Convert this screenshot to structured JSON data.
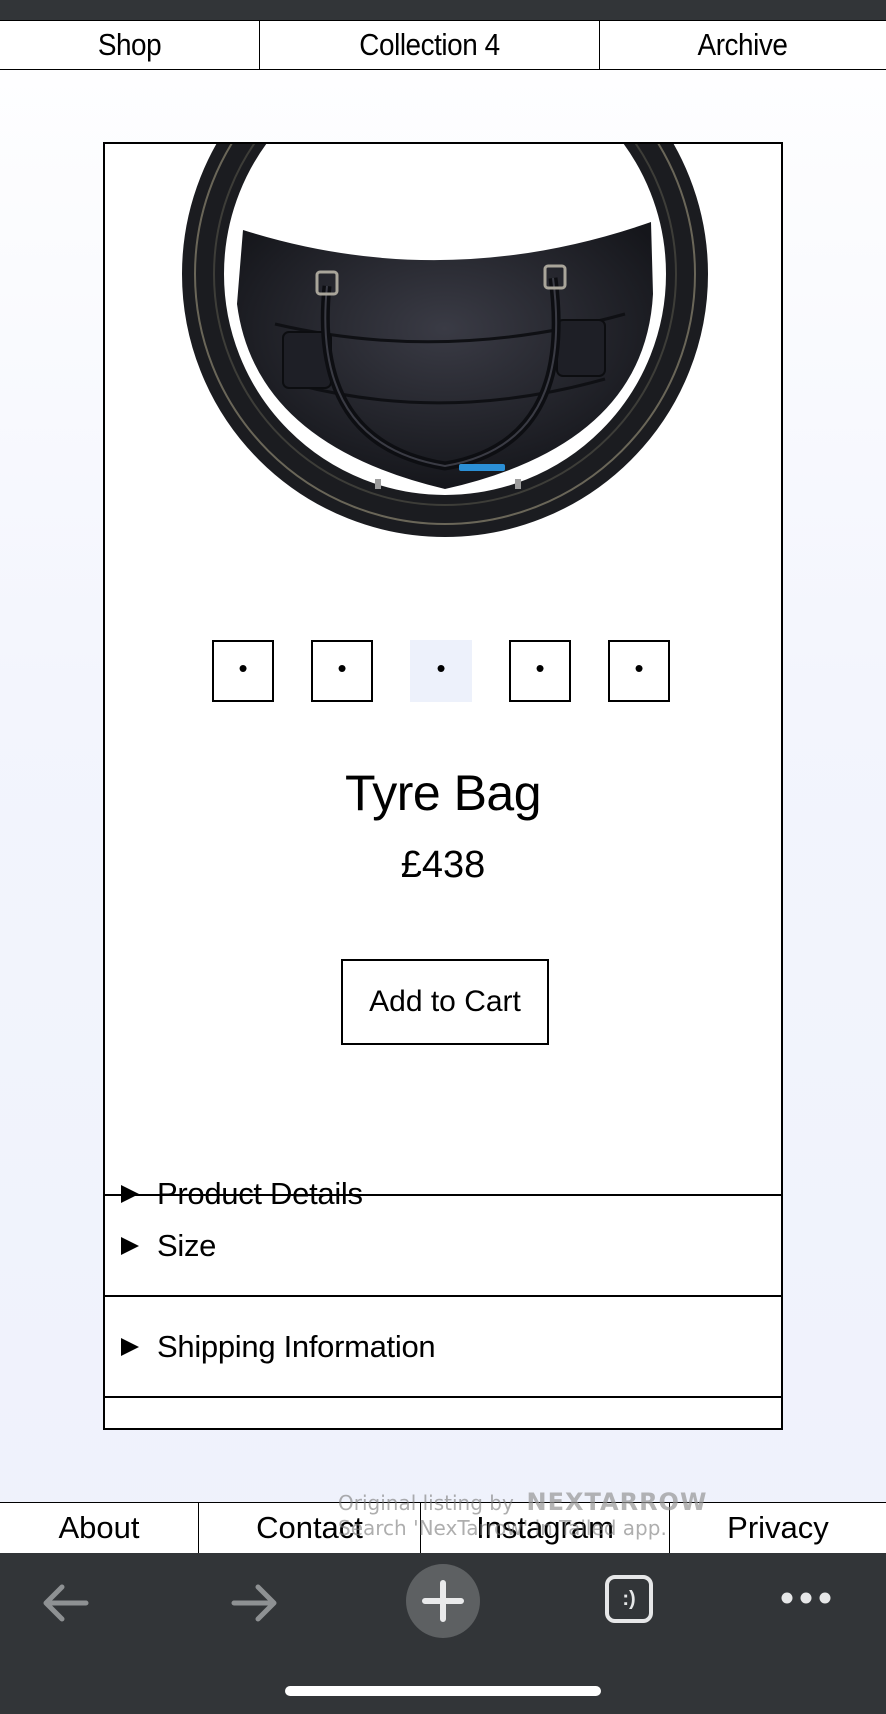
{
  "top_nav": {
    "items": [
      "Shop",
      "Collection 4",
      "Archive"
    ]
  },
  "product": {
    "title": "Tyre Bag",
    "price": "£438",
    "add_to_cart_label": "Add to Cart",
    "thumbnails": [
      "•",
      "•",
      "•",
      "•",
      "•"
    ],
    "active_thumbnail": 3
  },
  "accordion": {
    "items": [
      "Product Details",
      "Size",
      "Shipping Information"
    ]
  },
  "bottom_nav": {
    "items": [
      "About",
      "Contact",
      "Instagram",
      "Privacy"
    ]
  },
  "watermark": {
    "line1": "Original listing by",
    "brand": "NEXTARROW",
    "line2": "Search 'NexTarrow' in Tailed app."
  },
  "browser_toolbar": {
    "icons": [
      "back-arrow-icon",
      "forward-arrow-icon",
      "new-tab-plus-icon",
      "tab-switcher-icon",
      "more-dots-icon"
    ],
    "tab_switcher_label": ":)"
  }
}
